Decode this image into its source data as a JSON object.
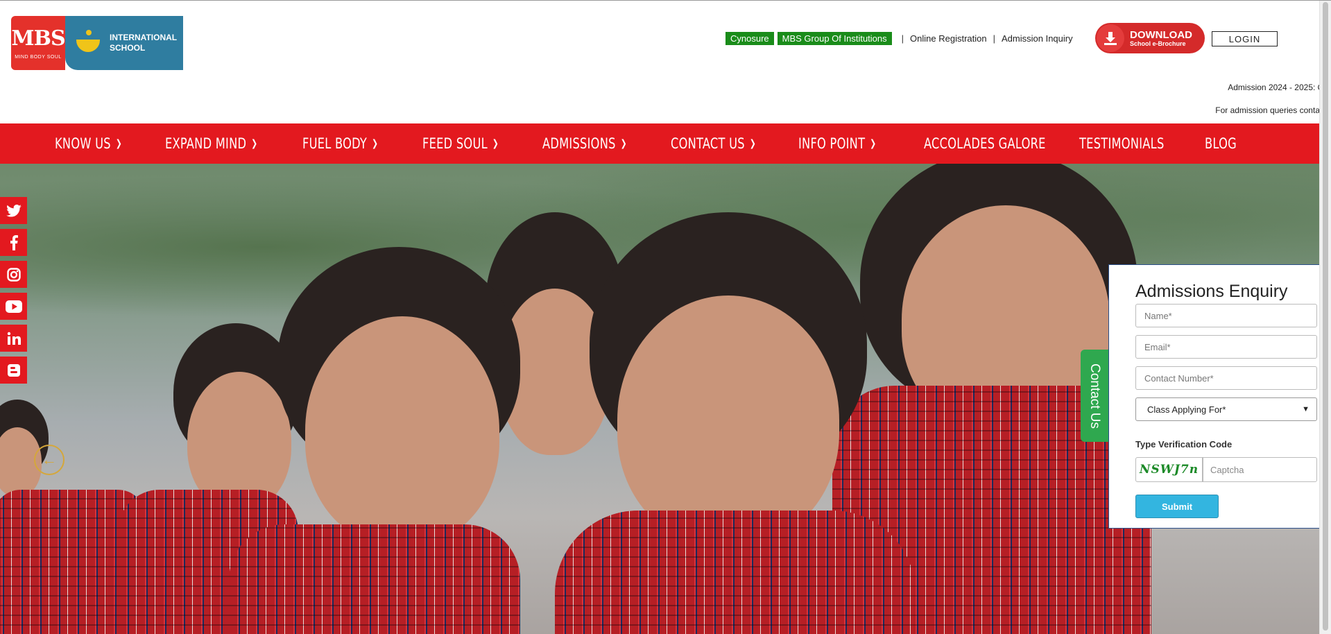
{
  "brand": {
    "logo_left_text": "MBS",
    "logo_left_sub": "MIND BODY SOUL",
    "logo_right_line1": "INTERNATIONAL",
    "logo_right_line2": "SCHOOL",
    "colors": {
      "red": "#e3191f",
      "blue": "#2f7da0",
      "green": "#1a8c1a"
    }
  },
  "toplinks": {
    "cynosure": "Cynosure",
    "group": "MBS Group Of Institutions",
    "separator": "|",
    "online_registration": "Online Registration",
    "admission_inquiry": "Admission Inquiry",
    "download_main": "DOWNLOAD",
    "download_sub": "School e-Brochure",
    "login": "LOGIN"
  },
  "ticker": {
    "line1": "Admission 2024 - 2025: O",
    "line2": "For admission queries contac"
  },
  "nav": [
    {
      "label": "KNOW US",
      "dropdown": true
    },
    {
      "label": "EXPAND MIND",
      "dropdown": true
    },
    {
      "label": "FUEL BODY",
      "dropdown": true
    },
    {
      "label": "FEED SOUL",
      "dropdown": true
    },
    {
      "label": "ADMISSIONS",
      "dropdown": true
    },
    {
      "label": "CONTACT US",
      "dropdown": true
    },
    {
      "label": "INFO POINT",
      "dropdown": true
    },
    {
      "label": "ACCOLADES GALORE",
      "dropdown": false
    },
    {
      "label": "TESTIMONIALS",
      "dropdown": false
    },
    {
      "label": "BLOG",
      "dropdown": false
    }
  ],
  "social": [
    "twitter-icon",
    "facebook-icon",
    "instagram-icon",
    "youtube-icon",
    "linkedin-icon",
    "blogger-icon"
  ],
  "contact_tab": "Contact Us",
  "enquiry": {
    "title": "Admissions Enquiry",
    "name_placeholder": "Name*",
    "email_placeholder": "Email*",
    "contact_placeholder": "Contact Number*",
    "class_select": "Class Applying For*",
    "verify_label": "Type Verification Code",
    "captcha_code": "NSWJ7n",
    "captcha_placeholder": "Captcha",
    "submit": "Submit"
  }
}
